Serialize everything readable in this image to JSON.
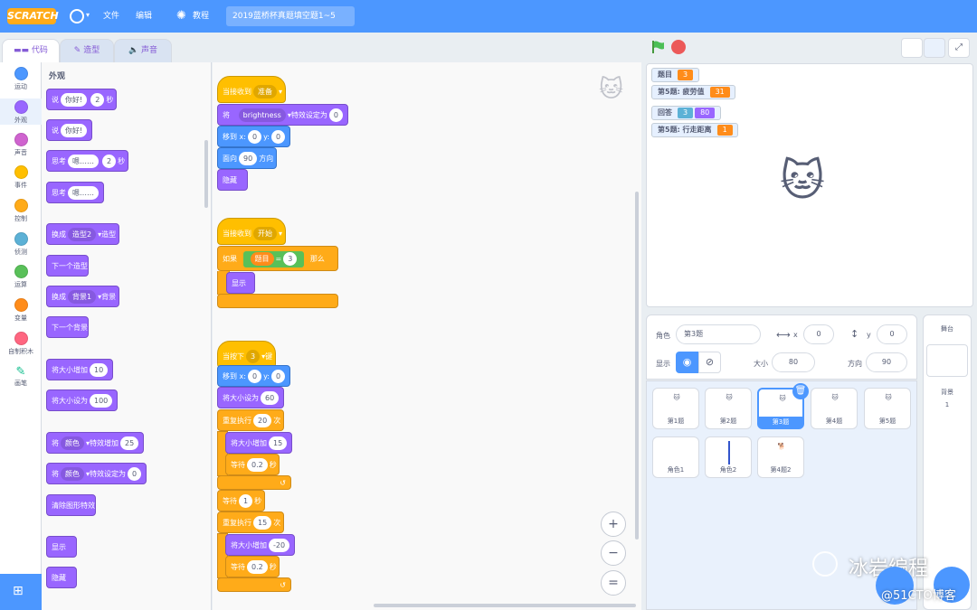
{
  "menubar": {
    "logo": "SCRATCH",
    "file": "文件",
    "edit": "编辑",
    "tutorials": "教程",
    "project_title": "2019蓝桥杯真题填空题1~5"
  },
  "tabs": {
    "code": "代码",
    "costumes": "造型",
    "sounds": "声音"
  },
  "categories": [
    {
      "label": "运动",
      "color": "#4c97ff"
    },
    {
      "label": "外观",
      "color": "#9966ff"
    },
    {
      "label": "声音",
      "color": "#cf63cf"
    },
    {
      "label": "事件",
      "color": "#ffbf00"
    },
    {
      "label": "控制",
      "color": "#ffab19"
    },
    {
      "label": "侦测",
      "color": "#5cb1d6"
    },
    {
      "label": "运算",
      "color": "#59c059"
    },
    {
      "label": "变量",
      "color": "#ff8c1a"
    },
    {
      "label": "自制积木",
      "color": "#ff6680"
    },
    {
      "label": "画笔",
      "color": "#0fbd8c"
    }
  ],
  "palette": {
    "heading": "外观",
    "say_secs": {
      "t1": "说",
      "v1": "你好!",
      "v2": "2",
      "t2": "秒"
    },
    "say": {
      "t1": "说",
      "v1": "你好!"
    },
    "think_secs": {
      "t1": "思考",
      "v1": "嗯……",
      "v2": "2",
      "t2": "秒"
    },
    "think": {
      "t1": "思考",
      "v1": "嗯……"
    },
    "switch_costume": {
      "t1": "换成",
      "v1": "造型2",
      "t2": "造型"
    },
    "next_costume": "下一个造型",
    "switch_backdrop": {
      "t1": "换成",
      "v1": "背景1",
      "t2": "背景"
    },
    "next_backdrop": "下一个背景",
    "change_size": {
      "t1": "将大小增加",
      "v1": "10"
    },
    "set_size": {
      "t1": "将大小设为",
      "v1": "100"
    },
    "change_effect": {
      "t1": "将",
      "v1": "颜色",
      "t2": "特效增加",
      "v2": "25"
    },
    "set_effect": {
      "t1": "将",
      "v1": "颜色",
      "t2": "特效设定为",
      "v2": "0"
    },
    "clear_effects": "清除图形特效",
    "show": "显示",
    "hide": "隐藏"
  },
  "scripts": {
    "s1": {
      "hat": "当接收到",
      "hat_msg": "准备",
      "set_effect": {
        "t1": "将",
        "v1": "brightness",
        "t2": "特效设定为",
        "v2": "0"
      },
      "goto": {
        "t1": "移到 x:",
        "v1": "0",
        "t2": "y:",
        "v2": "0"
      },
      "point": {
        "t1": "面向",
        "v1": "90",
        "t2": "方向"
      },
      "hide": "隐藏"
    },
    "s2": {
      "hat": "当接收到",
      "hat_msg": "开始",
      "if": "如果",
      "var": "题目",
      "eq": "=",
      "val": "3",
      "then": "那么",
      "show": "显示"
    },
    "s3": {
      "hat": "当按下",
      "key": "3",
      "key_t": "键",
      "goto": {
        "t1": "移到 x:",
        "v1": "0",
        "t2": "y:",
        "v2": "0"
      },
      "set_size": {
        "t1": "将大小设为",
        "v1": "60"
      },
      "repeat1": {
        "t1": "重复执行",
        "v1": "20",
        "t2": "次"
      },
      "change1": {
        "t1": "将大小增加",
        "v1": "15"
      },
      "wait1": {
        "t1": "等待",
        "v1": "0.2",
        "t2": "秒"
      },
      "wait_mid": {
        "t1": "等待",
        "v1": "1",
        "t2": "秒"
      },
      "repeat2": {
        "t1": "重复执行",
        "v1": "15",
        "t2": "次"
      },
      "change2": {
        "t1": "将大小增加",
        "v1": "-20"
      },
      "wait2": {
        "t1": "等待",
        "v1": "0.2",
        "t2": "秒"
      }
    }
  },
  "zoom": {
    "in": "+",
    "out": "−",
    "reset": "="
  },
  "monitors": [
    {
      "label": "题目",
      "value": "3"
    },
    {
      "label": "第5题: 疲劳值",
      "value": "31"
    },
    {
      "label": "回答",
      "value": "3",
      "extra": "80"
    },
    {
      "label": "第5题: 行走距离",
      "value": "1"
    }
  ],
  "sprite_info": {
    "sprite_label": "角色",
    "sprite_name": "第3题",
    "x_label": "x",
    "x": "0",
    "y_label": "y",
    "y": "0",
    "show_label": "显示",
    "size_label": "大小",
    "size": "80",
    "dir_label": "方向",
    "dir": "90"
  },
  "sprites": [
    {
      "name": "第1题"
    },
    {
      "name": "第2题"
    },
    {
      "name": "第3题"
    },
    {
      "name": "第4题"
    },
    {
      "name": "第5题"
    },
    {
      "name": "角色1"
    },
    {
      "name": "角色2"
    },
    {
      "name": "第4题2"
    }
  ],
  "stage_panel": {
    "title": "舞台",
    "backdrop_label": "背景",
    "backdrop_count": "1"
  },
  "watermark": {
    "brand": "冰岩编程",
    "site": "@51CTO博客"
  },
  "colors": {
    "accent": "#4c97ff",
    "looks": "#9966ff",
    "events": "#ffbf00",
    "control": "#ffab19",
    "operators": "#59c059",
    "variables": "#ff8c1a"
  }
}
